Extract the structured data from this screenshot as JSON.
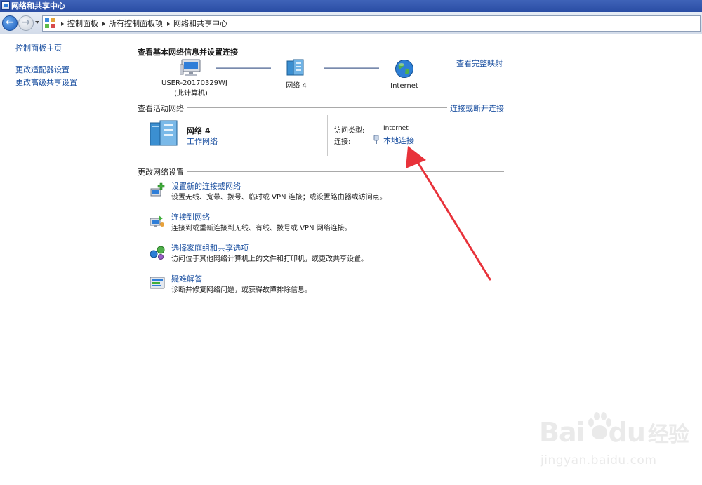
{
  "window": {
    "title": "网络和共享中心"
  },
  "addressbar": {
    "crumbs": [
      "控制面板",
      "所有控制面板项",
      "网络和共享中心"
    ]
  },
  "leftpane": {
    "home_link": "控制面板主页",
    "adapter_link": "更改适配器设置",
    "advanced_sharing_link": "更改高级共享设置"
  },
  "main": {
    "heading": "查看基本网络信息并设置连接",
    "full_map_link": "查看完整映射",
    "network_map": {
      "computer_name": "USER-20170329WJ",
      "computer_sub": "(此计算机)",
      "network_label": "网络  4",
      "internet_label": "Internet"
    },
    "active_networks": {
      "section_title": "查看活动网络",
      "connect_link": "连接或断开连接",
      "network_name": "网络  4",
      "network_type": "工作网络",
      "access_type_label": "访问类型:",
      "access_type_value": "Internet",
      "connections_label": "连接:",
      "connection_value": "本地连接"
    },
    "change_settings": {
      "section_title": "更改网络设置",
      "tasks": [
        {
          "title": "设置新的连接或网络",
          "desc": "设置无线、宽带、拨号、临时或 VPN 连接；或设置路由器或访问点。"
        },
        {
          "title": "连接到网络",
          "desc": "连接到或重新连接到无线、有线、拨号或 VPN 网络连接。"
        },
        {
          "title": "选择家庭组和共享选项",
          "desc": "访问位于其他网络计算机上的文件和打印机，或更改共享设置。"
        },
        {
          "title": "疑难解答",
          "desc": "诊断并修复网络问题，或获得故障排除信息。"
        }
      ]
    }
  },
  "annotation": {
    "color": "#e8323a"
  },
  "watermark": {
    "brand": "Bai",
    "brand2": "du",
    "suffix": "经验",
    "url": "jingyan.baidu.com"
  }
}
